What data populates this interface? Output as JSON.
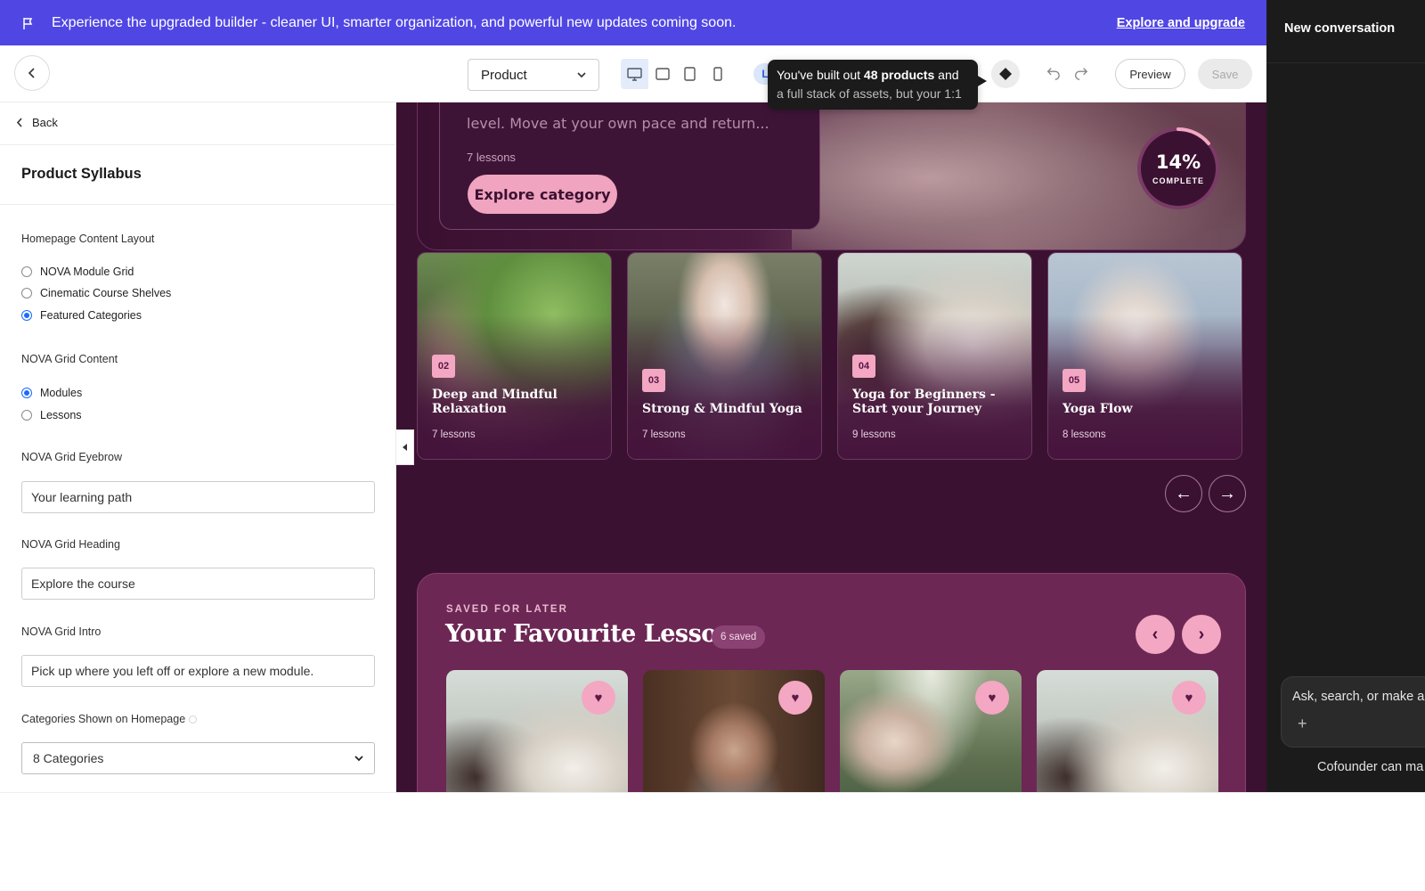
{
  "banner": {
    "message": "Experience the upgraded builder - cleaner UI, smarter organization, and powerful new updates coming soon.",
    "link": "Explore and upgrade"
  },
  "toolbar": {
    "page_select": "Product",
    "devices": [
      "desktop-icon",
      "tablet-landscape-icon",
      "tablet-portrait-icon",
      "mobile-icon"
    ],
    "active_device": "desktop",
    "lang_chip": "L",
    "tooltip": {
      "pre": "You've built out ",
      "bold": "48 products",
      "post": " and",
      "line2": "a full stack of assets, but your 1:1"
    },
    "preview": "Preview",
    "save": "Save"
  },
  "left_panel": {
    "back": "Back",
    "title": "Product Syllabus",
    "layout_label": "Homepage Content Layout",
    "layout_options": [
      "NOVA Module Grid",
      "Cinematic Course Shelves",
      "Featured Categories"
    ],
    "layout_selected": "Featured Categories",
    "grid_content_label": "NOVA Grid Content",
    "grid_content_options": [
      "Modules",
      "Lessons"
    ],
    "grid_content_selected": "Modules",
    "eyebrow_label": "NOVA Grid Eyebrow",
    "eyebrow_value": "Your learning path",
    "heading_label": "NOVA Grid Heading",
    "heading_value": "Explore the course",
    "intro_label": "NOVA Grid Intro",
    "intro_value": "Pick up where you left off or explore a new module.",
    "categories_label": "Categories Shown on Homepage",
    "categories_value": "8 Categories"
  },
  "canvas": {
    "hero": {
      "desc": "level. Move at your own pace and return...",
      "lessons": "7 lessons",
      "button": "Explore category",
      "progress_pct": "14%",
      "progress_value": 0.14,
      "progress_label": "COMPLETE"
    },
    "categories": [
      {
        "num": "02",
        "title": "Deep and Mindful Relaxation",
        "lessons": "7 lessons"
      },
      {
        "num": "03",
        "title": "Strong & Mindful Yoga",
        "lessons": "7 lessons"
      },
      {
        "num": "04",
        "title": "Yoga for Beginners - Start your Journey",
        "lessons": "9 lessons"
      },
      {
        "num": "05",
        "title": "Yoga Flow",
        "lessons": "8 lessons"
      }
    ],
    "cat_prev": "←",
    "cat_next": "→",
    "favourites": {
      "eyebrow": "SAVED FOR LATER",
      "heading": "Your Favourite Lessons",
      "badge": "6 saved",
      "prev": "‹",
      "next": "›",
      "heart": "♥"
    }
  },
  "right_panel": {
    "title": "New conversation",
    "input_placeholder": "Ask, search, or make a",
    "plus": "+",
    "footer": "Cofounder can ma"
  },
  "colors": {
    "banner": "#5046e4",
    "canvas_bg": "#3b1131",
    "accent_pink": "#f3a7c2",
    "favourites_bg": "#6c2754"
  }
}
